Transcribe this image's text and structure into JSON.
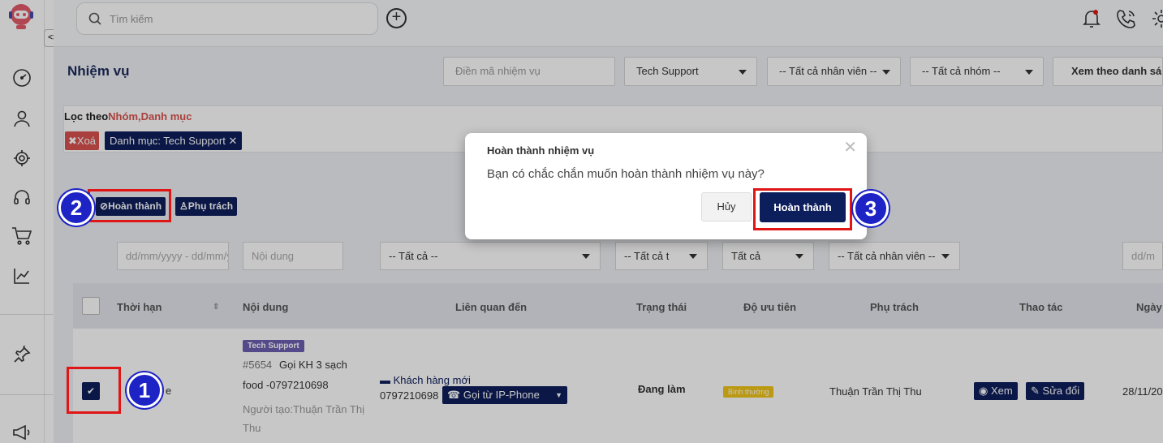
{
  "header": {
    "search_placeholder": "Tìm kiếm",
    "toggle_label": "<>"
  },
  "page": {
    "title": "Nhiệm vụ",
    "task_code_placeholder": "Điền mã nhiệm vụ",
    "category_select": "Tech Support",
    "staff_select": "-- Tất cả nhân viên --",
    "group_select": "-- Tất cả nhóm --",
    "view_button": "Xem theo danh sá"
  },
  "filter": {
    "label_prefix": "Lọc theo",
    "label_fields": "Nhóm,Danh mục",
    "clear_chip": "Xoá",
    "category_chip": "Danh mục: Tech Support"
  },
  "actions": {
    "complete_button": "Hoàn thành",
    "assign_button": "Phụ trách"
  },
  "column_filters": {
    "date_range": "dd/mm/yyyy - dd/mm/y",
    "content": "Nội dung",
    "related": "-- Tất cả --",
    "status": "-- Tất cả t",
    "priority": "Tất cả",
    "assignee": "-- Tất cả nhân viên --",
    "date_end": "dd/m"
  },
  "table": {
    "headers": [
      "Thời hạn",
      "Nội dung",
      "Liên quan đến",
      "Trạng thái",
      "Độ ưu tiên",
      "Phụ trách",
      "Thao tác",
      "Ngày"
    ],
    "row": {
      "deadline_fragment": "e",
      "tag": "Tech Support",
      "task_id": "#5654",
      "content_line1": "Gọi KH 3 sạch",
      "content_line2": "food -0797210698",
      "creator_line1": "Người tạo:Thuận Trần Thị",
      "creator_line2": "Thu",
      "customer": "Khách hàng mới",
      "phone": "0797210698",
      "call_button": "Gọi từ IP-Phone",
      "status": "Đang làm",
      "priority": "Bình thường",
      "assignee": "Thuận Trần Thị Thu",
      "view_button": "Xem",
      "edit_button": "Sửa đổi",
      "date": "28/11/20"
    }
  },
  "annotations": {
    "step1": "1",
    "step2": "2",
    "step3": "3"
  },
  "modal": {
    "title": "Hoàn thành nhiệm vụ",
    "message": "Bạn có chắc chắn muốn hoàn thành nhiệm vụ này?",
    "cancel": "Hủy",
    "confirm": "Hoàn thành"
  },
  "colors": {
    "primary": "#0d1e5c",
    "danger": "#d9534f",
    "tag_purple": "#6c5fb0",
    "priority_yellow": "#f0c419",
    "annotation_red": "#e01515",
    "annotation_blue": "#1d23c5"
  }
}
